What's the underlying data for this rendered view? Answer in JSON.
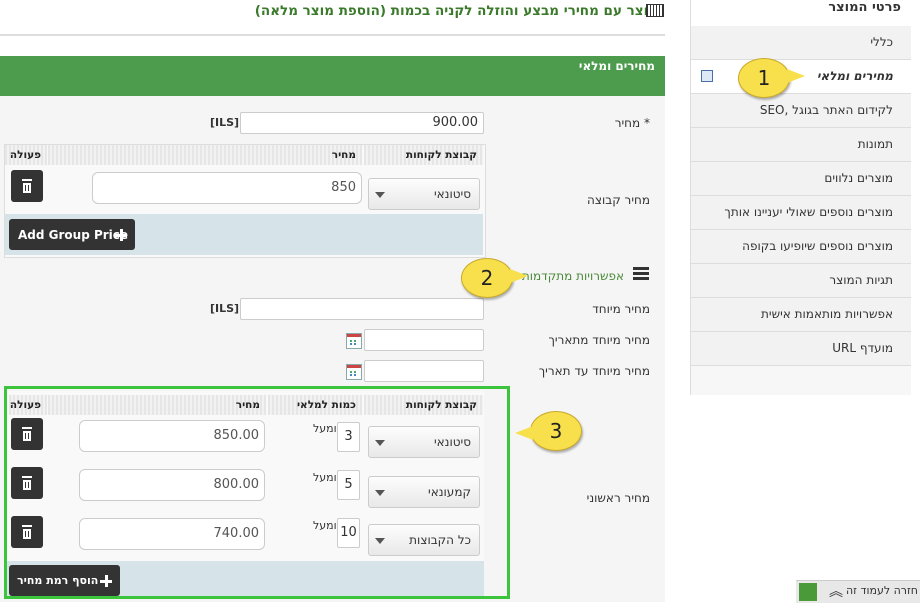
{
  "page": {
    "title": "מוצר עם מחירי מבצע והוזלה לקניה בכמות (הוספת מוצר מלאה)",
    "section_title": "מחירים ומלאי"
  },
  "sidebar": {
    "header": "פרטי המוצר",
    "items": [
      {
        "label": "כללי"
      },
      {
        "label": "מחירים ומלאי",
        "active": true
      },
      {
        "label": "SEO, לקידום האתר בגוגל"
      },
      {
        "label": "תמונות"
      },
      {
        "label": "מוצרים נלווים"
      },
      {
        "label": "מוצרים נוספים שאולי יעניינו אותך"
      },
      {
        "label": "מוצרים נוספים שיופיעו בקופה"
      },
      {
        "label": "תגיות המוצר"
      },
      {
        "label": "אפשרויות מותאמות אישית"
      },
      {
        "label": "URL מועדף"
      }
    ]
  },
  "price": {
    "label": "מחיר *",
    "value": "900.00",
    "currency": "[ILS]"
  },
  "group_price": {
    "label": "מחיר קבוצה",
    "headers": {
      "group": "קבוצת לקוחות",
      "price": "מחיר",
      "action": "פעולה"
    },
    "row": {
      "group": "סיטונאי",
      "price": "850"
    },
    "add_button": "Add Group Price"
  },
  "advanced": {
    "label": "אפשרויות מתקדמות"
  },
  "special": {
    "price_label": "מחיר מיוחד",
    "currency": "[ILS]",
    "from_label": "מחיר מיוחד מתאריך",
    "to_label": "מחיר מיוחד עד תאריך"
  },
  "tier": {
    "label": "מחיר ראשוני",
    "headers": {
      "group": "קבוצת לקוחות",
      "qty": "כמות למלאי",
      "price": "מחיר",
      "action": "פעולה"
    },
    "and_up": "ומעל",
    "rows": [
      {
        "group": "סיטונאי",
        "qty": "3",
        "price": "850.00"
      },
      {
        "group": "קמעונאי",
        "qty": "5",
        "price": "800.00"
      },
      {
        "group": "כל הקבוצות",
        "qty": "10",
        "price": "740.00"
      }
    ],
    "add_button": "הוסף רמת מחיר"
  },
  "callouts": {
    "one": "1",
    "two": "2",
    "three": "3"
  },
  "footer": {
    "back_label": "חזרה לעמוד זה"
  }
}
